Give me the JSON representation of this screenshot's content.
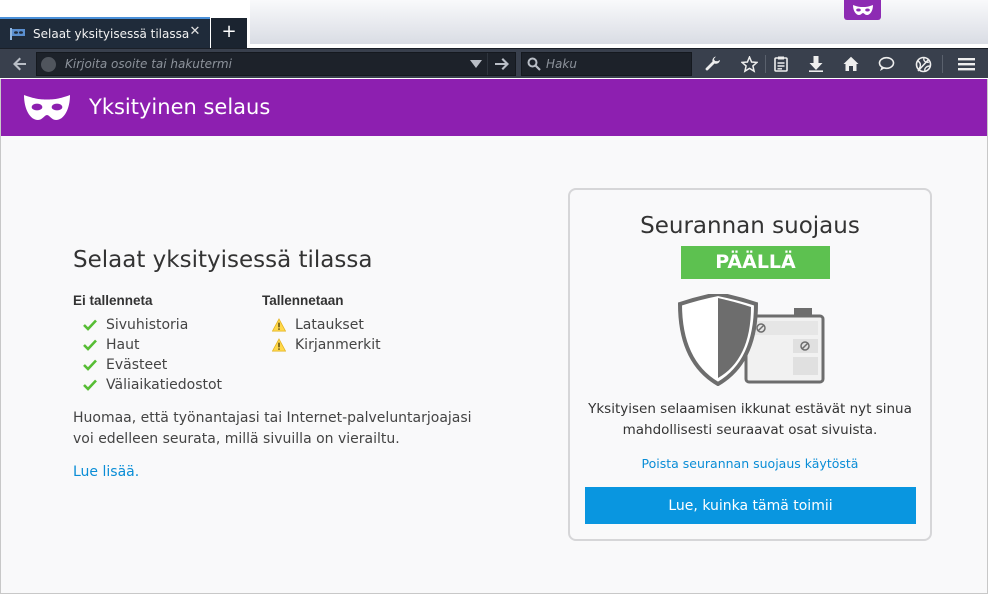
{
  "tab": {
    "title": "Selaat yksityisessä tilassa",
    "close_glyph": "✕",
    "new_tab_glyph": "+"
  },
  "toolbar": {
    "url_placeholder": "Kirjoita osoite tai hakutermi",
    "search_placeholder": "Haku",
    "icons": [
      "back-icon",
      "site-identity-icon",
      "url-history-dropdown-icon",
      "go-arrow-icon",
      "search-icon",
      "developer-wrench-icon",
      "bookmark-star-icon",
      "reading-list-icon",
      "downloads-icon",
      "home-icon",
      "chat-bubble-icon",
      "tracking-globe-icon",
      "menu-hamburger-icon"
    ]
  },
  "header": {
    "title": "Yksityinen selaus"
  },
  "main": {
    "heading": "Selaat yksityisessä tilassa",
    "not_saved": {
      "heading": "Ei tallenneta",
      "items": [
        "Sivuhistoria",
        "Haut",
        "Evästeet",
        "Väliaikatiedostot"
      ]
    },
    "saved": {
      "heading": "Tallennetaan",
      "items": [
        "Lataukset",
        "Kirjanmerkit"
      ]
    },
    "note": "Huomaa, että työnantajasi tai Internet-palveluntarjoajasi voi edelleen seurata, millä sivuilla on vierailtu.",
    "learn_more": "Lue lisää."
  },
  "tracking_protection": {
    "heading": "Seurannan suojaus",
    "status": "PÄÄLLÄ",
    "description": "Yksityisen selaamisen ikkunat estävät nyt sinua mahdollisesti seuraavat osat sivuista.",
    "disable_link": "Poista seurannan suojaus käytöstä",
    "how_button": "Lue, kuinka tämä toimii"
  },
  "colors": {
    "header_purple": "#8d1fb0",
    "status_green": "#5dc150",
    "button_blue": "#0996e0",
    "link_blue": "#0a8dd6",
    "check_green": "#57bd35",
    "warning_yellow": "#ffd84a"
  }
}
